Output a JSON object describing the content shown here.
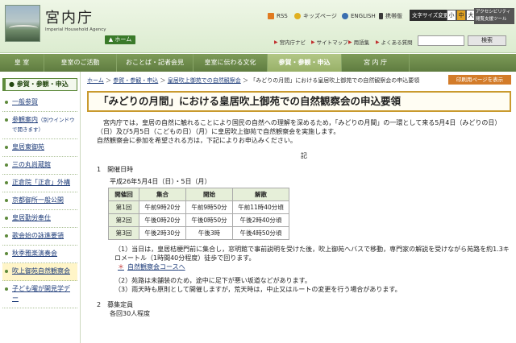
{
  "header": {
    "site_title": "宮内庁",
    "site_subtitle": "Imperial Household Agency",
    "home_label": "ホーム",
    "util_links": [
      {
        "label": "RSS",
        "color": "#e07a20"
      },
      {
        "label": "キッズページ",
        "color": "#e0b020"
      },
      {
        "label": "ENGLISH",
        "color": "#3a6fb0"
      },
      {
        "label": "携帯版",
        "color": "#3a3a3a"
      }
    ],
    "textsize_label": "文字サイズ変更",
    "size_small": "小",
    "size_medium": "中",
    "size_large": "大",
    "accessibility_label": "アクセシビリティ閲覧支援ツール",
    "sub_links": [
      "宮内庁ナビ",
      "サイトマップ",
      "用語集",
      "よくある質問"
    ],
    "search_button": "検索"
  },
  "gnav": [
    {
      "label": "皇 室",
      "active": false
    },
    {
      "label": "皇室のご活動",
      "active": false
    },
    {
      "label": "おことば・記者会見",
      "active": false
    },
    {
      "label": "皇室に伝わる文化",
      "active": false
    },
    {
      "label": "参賀・参観・申込",
      "active": true
    },
    {
      "label": "宮 内 庁",
      "active": false
    }
  ],
  "sidebar": {
    "heading": "参賀・参観・申込",
    "items": [
      {
        "label": "一般参賀"
      },
      {
        "label": "参観案内",
        "note": "（別ウインドウで開きます）"
      },
      {
        "label": "皇居東御苑"
      },
      {
        "label": "三の丸尚蔵館"
      },
      {
        "label": "正倉院「正倉」外構"
      },
      {
        "label": "京都御所一般公開"
      },
      {
        "label": "皇居勤労奉仕"
      },
      {
        "label": "歌会始の詠進要領"
      },
      {
        "label": "秋季雅楽演奏会"
      },
      {
        "label": "吹上御苑自然観察会",
        "current": true
      },
      {
        "label": "子ども曜が開見学デー"
      }
    ]
  },
  "main": {
    "breadcrumb": {
      "items": [
        "ホーム",
        "参賀・参観・申込",
        "皇居吹上御苑での自然観察会"
      ],
      "current": "「みどりの月間」における皇居吹上御苑での自然観察会の申込要領"
    },
    "print_label": "印刷用ページを表示",
    "title": "「みどりの月間」における皇居吹上御苑での自然観察会の申込要領",
    "intro_1": "宮内庁では，皇居の自然に触れることにより国民の自然への理解を深めるため，「みどりの月間」の一環として来る5月4日（みどりの日）（日）及び5月5日（こどもの日）（月）に皇居吹上御苑で自然観察会を実施します。",
    "intro_2": "自然観察会に参加を希望される方は，下記によりお申込みください。",
    "ki": "記",
    "sec1_title": "1　開催日時",
    "sec1_date": "平成26年5月4日（日）・5日（月）",
    "table": {
      "headers": [
        "開催回",
        "集合",
        "開始",
        "解散"
      ],
      "rows": [
        [
          "第1回",
          "午前9時20分",
          "午前9時50分",
          "午前11時40分頃"
        ],
        [
          "第2回",
          "午後0時20分",
          "午後0時50分",
          "午後2時40分頃"
        ],
        [
          "第3回",
          "午後2時30分",
          "午後3時",
          "午後4時50分頃"
        ]
      ]
    },
    "note_1": "（1）当日は，皇居桔梗門前に集合し，窓明館で事前説明を受けた後，吹上御苑へバスで移動，専門家の解説を受けながら苑路を約1.3キロメートル（1時間40分程度）徒歩で回ります。",
    "note_link_prefix": "＊",
    "note_link": "自然観察会コース",
    "note_link_suffix": "へ",
    "note_2": "（2）苑路は未舗装のため，途中に足下が悪い坂道などがあります。",
    "note_3": "（3）雨天時も原則として開催しますが，荒天時は，中止又はルートの変更を行う場合があります。",
    "sec2_title": "2　募集定員",
    "sec2_body": "各回30人程度"
  }
}
